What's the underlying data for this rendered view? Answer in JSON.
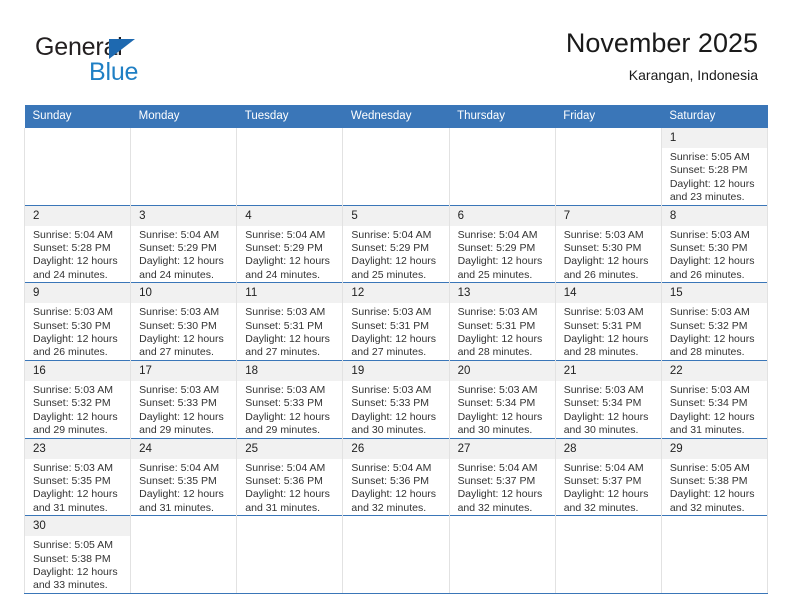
{
  "brand": {
    "name_top": "General",
    "name_bottom": "Blue",
    "triangle_icon": "blue-triangle-logo-mark",
    "accent_color": "#1f7fc4"
  },
  "header": {
    "title": "November 2025",
    "subtitle": "Karangan, Indonesia"
  },
  "calendar": {
    "header_color": "#3a76b8",
    "weekday_headers": [
      "Sunday",
      "Monday",
      "Tuesday",
      "Wednesday",
      "Thursday",
      "Friday",
      "Saturday"
    ],
    "weeks": [
      [
        {
          "day": "",
          "sunrise": "",
          "sunset": "",
          "daylight1": "",
          "daylight2": ""
        },
        {
          "day": "",
          "sunrise": "",
          "sunset": "",
          "daylight1": "",
          "daylight2": ""
        },
        {
          "day": "",
          "sunrise": "",
          "sunset": "",
          "daylight1": "",
          "daylight2": ""
        },
        {
          "day": "",
          "sunrise": "",
          "sunset": "",
          "daylight1": "",
          "daylight2": ""
        },
        {
          "day": "",
          "sunrise": "",
          "sunset": "",
          "daylight1": "",
          "daylight2": ""
        },
        {
          "day": "",
          "sunrise": "",
          "sunset": "",
          "daylight1": "",
          "daylight2": ""
        },
        {
          "day": "1",
          "sunrise": "Sunrise: 5:05 AM",
          "sunset": "Sunset: 5:28 PM",
          "daylight1": "Daylight: 12 hours",
          "daylight2": "and 23 minutes."
        }
      ],
      [
        {
          "day": "2",
          "sunrise": "Sunrise: 5:04 AM",
          "sunset": "Sunset: 5:28 PM",
          "daylight1": "Daylight: 12 hours",
          "daylight2": "and 24 minutes."
        },
        {
          "day": "3",
          "sunrise": "Sunrise: 5:04 AM",
          "sunset": "Sunset: 5:29 PM",
          "daylight1": "Daylight: 12 hours",
          "daylight2": "and 24 minutes."
        },
        {
          "day": "4",
          "sunrise": "Sunrise: 5:04 AM",
          "sunset": "Sunset: 5:29 PM",
          "daylight1": "Daylight: 12 hours",
          "daylight2": "and 24 minutes."
        },
        {
          "day": "5",
          "sunrise": "Sunrise: 5:04 AM",
          "sunset": "Sunset: 5:29 PM",
          "daylight1": "Daylight: 12 hours",
          "daylight2": "and 25 minutes."
        },
        {
          "day": "6",
          "sunrise": "Sunrise: 5:04 AM",
          "sunset": "Sunset: 5:29 PM",
          "daylight1": "Daylight: 12 hours",
          "daylight2": "and 25 minutes."
        },
        {
          "day": "7",
          "sunrise": "Sunrise: 5:03 AM",
          "sunset": "Sunset: 5:30 PM",
          "daylight1": "Daylight: 12 hours",
          "daylight2": "and 26 minutes."
        },
        {
          "day": "8",
          "sunrise": "Sunrise: 5:03 AM",
          "sunset": "Sunset: 5:30 PM",
          "daylight1": "Daylight: 12 hours",
          "daylight2": "and 26 minutes."
        }
      ],
      [
        {
          "day": "9",
          "sunrise": "Sunrise: 5:03 AM",
          "sunset": "Sunset: 5:30 PM",
          "daylight1": "Daylight: 12 hours",
          "daylight2": "and 26 minutes."
        },
        {
          "day": "10",
          "sunrise": "Sunrise: 5:03 AM",
          "sunset": "Sunset: 5:30 PM",
          "daylight1": "Daylight: 12 hours",
          "daylight2": "and 27 minutes."
        },
        {
          "day": "11",
          "sunrise": "Sunrise: 5:03 AM",
          "sunset": "Sunset: 5:31 PM",
          "daylight1": "Daylight: 12 hours",
          "daylight2": "and 27 minutes."
        },
        {
          "day": "12",
          "sunrise": "Sunrise: 5:03 AM",
          "sunset": "Sunset: 5:31 PM",
          "daylight1": "Daylight: 12 hours",
          "daylight2": "and 27 minutes."
        },
        {
          "day": "13",
          "sunrise": "Sunrise: 5:03 AM",
          "sunset": "Sunset: 5:31 PM",
          "daylight1": "Daylight: 12 hours",
          "daylight2": "and 28 minutes."
        },
        {
          "day": "14",
          "sunrise": "Sunrise: 5:03 AM",
          "sunset": "Sunset: 5:31 PM",
          "daylight1": "Daylight: 12 hours",
          "daylight2": "and 28 minutes."
        },
        {
          "day": "15",
          "sunrise": "Sunrise: 5:03 AM",
          "sunset": "Sunset: 5:32 PM",
          "daylight1": "Daylight: 12 hours",
          "daylight2": "and 28 minutes."
        }
      ],
      [
        {
          "day": "16",
          "sunrise": "Sunrise: 5:03 AM",
          "sunset": "Sunset: 5:32 PM",
          "daylight1": "Daylight: 12 hours",
          "daylight2": "and 29 minutes."
        },
        {
          "day": "17",
          "sunrise": "Sunrise: 5:03 AM",
          "sunset": "Sunset: 5:33 PM",
          "daylight1": "Daylight: 12 hours",
          "daylight2": "and 29 minutes."
        },
        {
          "day": "18",
          "sunrise": "Sunrise: 5:03 AM",
          "sunset": "Sunset: 5:33 PM",
          "daylight1": "Daylight: 12 hours",
          "daylight2": "and 29 minutes."
        },
        {
          "day": "19",
          "sunrise": "Sunrise: 5:03 AM",
          "sunset": "Sunset: 5:33 PM",
          "daylight1": "Daylight: 12 hours",
          "daylight2": "and 30 minutes."
        },
        {
          "day": "20",
          "sunrise": "Sunrise: 5:03 AM",
          "sunset": "Sunset: 5:34 PM",
          "daylight1": "Daylight: 12 hours",
          "daylight2": "and 30 minutes."
        },
        {
          "day": "21",
          "sunrise": "Sunrise: 5:03 AM",
          "sunset": "Sunset: 5:34 PM",
          "daylight1": "Daylight: 12 hours",
          "daylight2": "and 30 minutes."
        },
        {
          "day": "22",
          "sunrise": "Sunrise: 5:03 AM",
          "sunset": "Sunset: 5:34 PM",
          "daylight1": "Daylight: 12 hours",
          "daylight2": "and 31 minutes."
        }
      ],
      [
        {
          "day": "23",
          "sunrise": "Sunrise: 5:03 AM",
          "sunset": "Sunset: 5:35 PM",
          "daylight1": "Daylight: 12 hours",
          "daylight2": "and 31 minutes."
        },
        {
          "day": "24",
          "sunrise": "Sunrise: 5:04 AM",
          "sunset": "Sunset: 5:35 PM",
          "daylight1": "Daylight: 12 hours",
          "daylight2": "and 31 minutes."
        },
        {
          "day": "25",
          "sunrise": "Sunrise: 5:04 AM",
          "sunset": "Sunset: 5:36 PM",
          "daylight1": "Daylight: 12 hours",
          "daylight2": "and 31 minutes."
        },
        {
          "day": "26",
          "sunrise": "Sunrise: 5:04 AM",
          "sunset": "Sunset: 5:36 PM",
          "daylight1": "Daylight: 12 hours",
          "daylight2": "and 32 minutes."
        },
        {
          "day": "27",
          "sunrise": "Sunrise: 5:04 AM",
          "sunset": "Sunset: 5:37 PM",
          "daylight1": "Daylight: 12 hours",
          "daylight2": "and 32 minutes."
        },
        {
          "day": "28",
          "sunrise": "Sunrise: 5:04 AM",
          "sunset": "Sunset: 5:37 PM",
          "daylight1": "Daylight: 12 hours",
          "daylight2": "and 32 minutes."
        },
        {
          "day": "29",
          "sunrise": "Sunrise: 5:05 AM",
          "sunset": "Sunset: 5:38 PM",
          "daylight1": "Daylight: 12 hours",
          "daylight2": "and 32 minutes."
        }
      ],
      [
        {
          "day": "30",
          "sunrise": "Sunrise: 5:05 AM",
          "sunset": "Sunset: 5:38 PM",
          "daylight1": "Daylight: 12 hours",
          "daylight2": "and 33 minutes."
        },
        {
          "day": "",
          "sunrise": "",
          "sunset": "",
          "daylight1": "",
          "daylight2": ""
        },
        {
          "day": "",
          "sunrise": "",
          "sunset": "",
          "daylight1": "",
          "daylight2": ""
        },
        {
          "day": "",
          "sunrise": "",
          "sunset": "",
          "daylight1": "",
          "daylight2": ""
        },
        {
          "day": "",
          "sunrise": "",
          "sunset": "",
          "daylight1": "",
          "daylight2": ""
        },
        {
          "day": "",
          "sunrise": "",
          "sunset": "",
          "daylight1": "",
          "daylight2": ""
        },
        {
          "day": "",
          "sunrise": "",
          "sunset": "",
          "daylight1": "",
          "daylight2": ""
        }
      ]
    ]
  }
}
